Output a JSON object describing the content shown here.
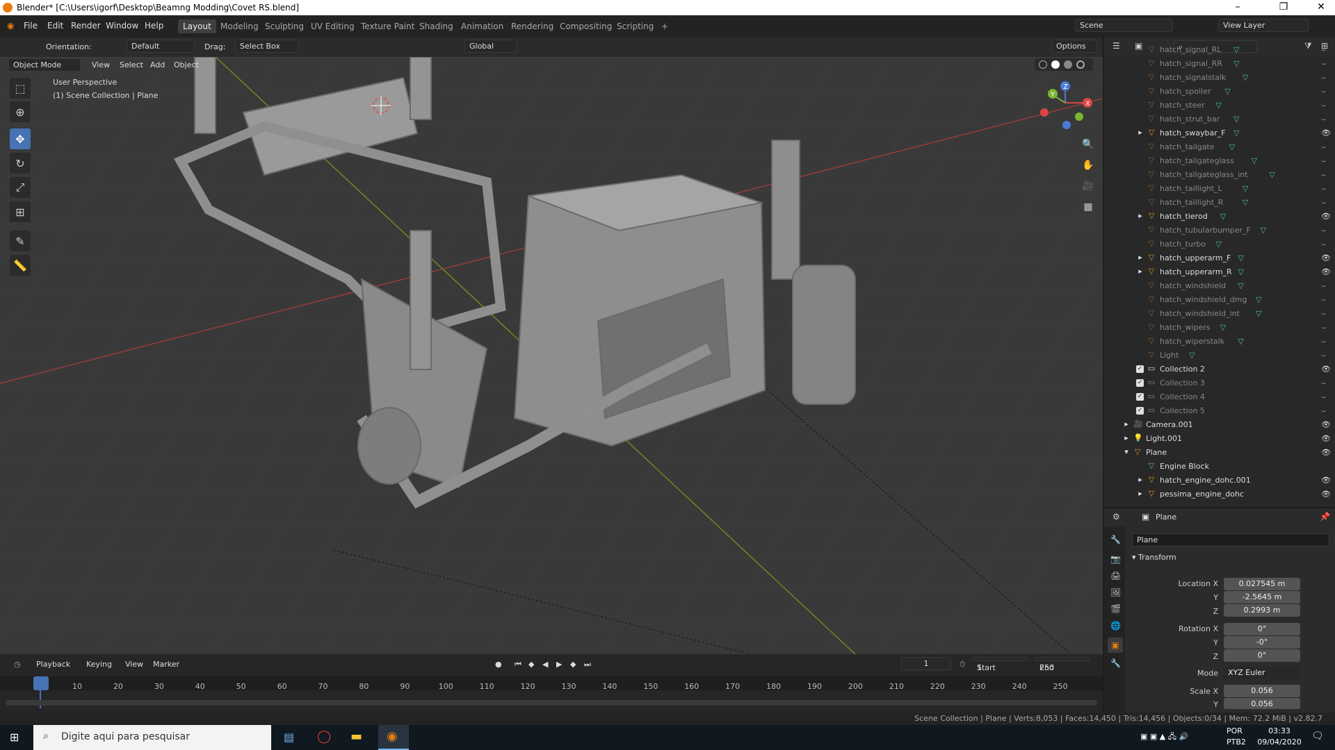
{
  "window": {
    "title": "Blender* [C:\\Users\\igorf\\Desktop\\Beamng Modding\\Covet RS.blend]",
    "minimize": "–",
    "maximize": "❐",
    "close": "✕"
  },
  "menu": {
    "items": [
      "File",
      "Edit",
      "Render",
      "Window",
      "Help"
    ],
    "workspaces": [
      "Layout",
      "Modeling",
      "Sculpting",
      "UV Editing",
      "Texture Paint",
      "Shading",
      "Animation",
      "Rendering",
      "Compositing",
      "Scripting"
    ],
    "add_tab": "+",
    "scene_label": "Scene",
    "view_layer_label": "View Layer"
  },
  "toolheader": {
    "orientation_label": "Orientation:",
    "orientation_value": "Default",
    "drag_label": "Drag:",
    "drag_value": "Select Box",
    "transform_orientation": "Global",
    "options": "Options"
  },
  "viewport_header": {
    "mode": "Object Mode",
    "menus": [
      "View",
      "Select",
      "Add",
      "Object"
    ]
  },
  "viewport": {
    "perspective": "User Perspective",
    "collection": "(1) Scene Collection | Plane",
    "gizmo": {
      "x": "X",
      "y": "Y",
      "z": "Z"
    }
  },
  "outliner": {
    "items": [
      {
        "label": "hatch_signal_RL",
        "dim": true,
        "exp": false
      },
      {
        "label": "hatch_signal_RR",
        "dim": true,
        "exp": false
      },
      {
        "label": "hatch_signalstalk",
        "dim": true,
        "exp": false
      },
      {
        "label": "hatch_spoiler",
        "dim": true,
        "exp": false
      },
      {
        "label": "hatch_steer",
        "dim": true,
        "exp": false
      },
      {
        "label": "hatch_strut_bar",
        "dim": true,
        "exp": false
      },
      {
        "label": "hatch_swaybar_F",
        "dim": false,
        "exp": true
      },
      {
        "label": "hatch_tailgate",
        "dim": true,
        "exp": false
      },
      {
        "label": "hatch_tailgateglass",
        "dim": true,
        "exp": false
      },
      {
        "label": "hatch_tailgateglass_int",
        "dim": true,
        "exp": false
      },
      {
        "label": "hatch_taillight_L",
        "dim": true,
        "exp": false
      },
      {
        "label": "hatch_taillight_R",
        "dim": true,
        "exp": false
      },
      {
        "label": "hatch_tierod",
        "dim": false,
        "exp": true
      },
      {
        "label": "hatch_tubularbumper_F",
        "dim": true,
        "exp": false
      },
      {
        "label": "hatch_turbo",
        "dim": true,
        "exp": false
      },
      {
        "label": "hatch_upperarm_F",
        "dim": false,
        "exp": true
      },
      {
        "label": "hatch_upperarm_R",
        "dim": false,
        "exp": true
      },
      {
        "label": "hatch_windshield",
        "dim": true,
        "exp": false
      },
      {
        "label": "hatch_windshield_dmg",
        "dim": true,
        "exp": false
      },
      {
        "label": "hatch_windshield_int",
        "dim": true,
        "exp": false
      },
      {
        "label": "hatch_wipers",
        "dim": true,
        "exp": false
      },
      {
        "label": "hatch_wiperstalk",
        "dim": true,
        "exp": false
      },
      {
        "label": "Light",
        "dim": true,
        "exp": false
      }
    ],
    "collections": [
      {
        "label": "Collection 2",
        "dim": false
      },
      {
        "label": "Collection 3",
        "dim": true
      },
      {
        "label": "Collection 4",
        "dim": true
      },
      {
        "label": "Collection 5",
        "dim": true
      }
    ],
    "scene_objects": [
      {
        "label": "Camera.001",
        "icon": "camera"
      },
      {
        "label": "Light.001",
        "icon": "light"
      },
      {
        "label": "Plane",
        "icon": "mesh"
      }
    ],
    "plane_children": [
      {
        "label": "Engine Block",
        "eye": false
      },
      {
        "label": "hatch_engine_dohc.001",
        "eye": true
      },
      {
        "label": "pessima_engine_dohc",
        "eye": true
      }
    ]
  },
  "properties": {
    "header_object": "Plane",
    "object_name": "Plane",
    "panel": "Transform",
    "location": {
      "label": "Location X",
      "x": "0.027545 m",
      "y": "-2.5645 m",
      "z": "0.2993 m"
    },
    "rotation": {
      "label": "Rotation X",
      "x": "0°",
      "y": "-0°",
      "z": "0°"
    },
    "mode": {
      "label": "Mode",
      "value": "XYZ Euler"
    },
    "scale": {
      "label": "Scale X",
      "x": "0.056",
      "y": "0.056"
    },
    "axis_y": "Y",
    "axis_z": "Z"
  },
  "timeline": {
    "menus": [
      "Playback",
      "Keying",
      "View",
      "Marker"
    ],
    "current_frame": "1",
    "start_label": "Start",
    "start": "1",
    "end_label": "End",
    "end": "250",
    "ticks": [
      "1",
      "10",
      "20",
      "30",
      "40",
      "50",
      "60",
      "70",
      "80",
      "90",
      "100",
      "110",
      "120",
      "130",
      "140",
      "150",
      "160",
      "170",
      "180",
      "190",
      "200",
      "210",
      "220",
      "230",
      "240",
      "250"
    ]
  },
  "statusbar": {
    "info": "Scene Collection | Plane | Verts:8,053 | Faces:14,450 | Tris:14,456 | Objects:0/34 | Mem: 72.2 MiB | v2.82.7"
  },
  "taskbar": {
    "search_placeholder": "Digite aqui para pesquisar",
    "lang": "POR",
    "layout": "PTB2",
    "time": "03:33",
    "date": "09/04/2020"
  }
}
